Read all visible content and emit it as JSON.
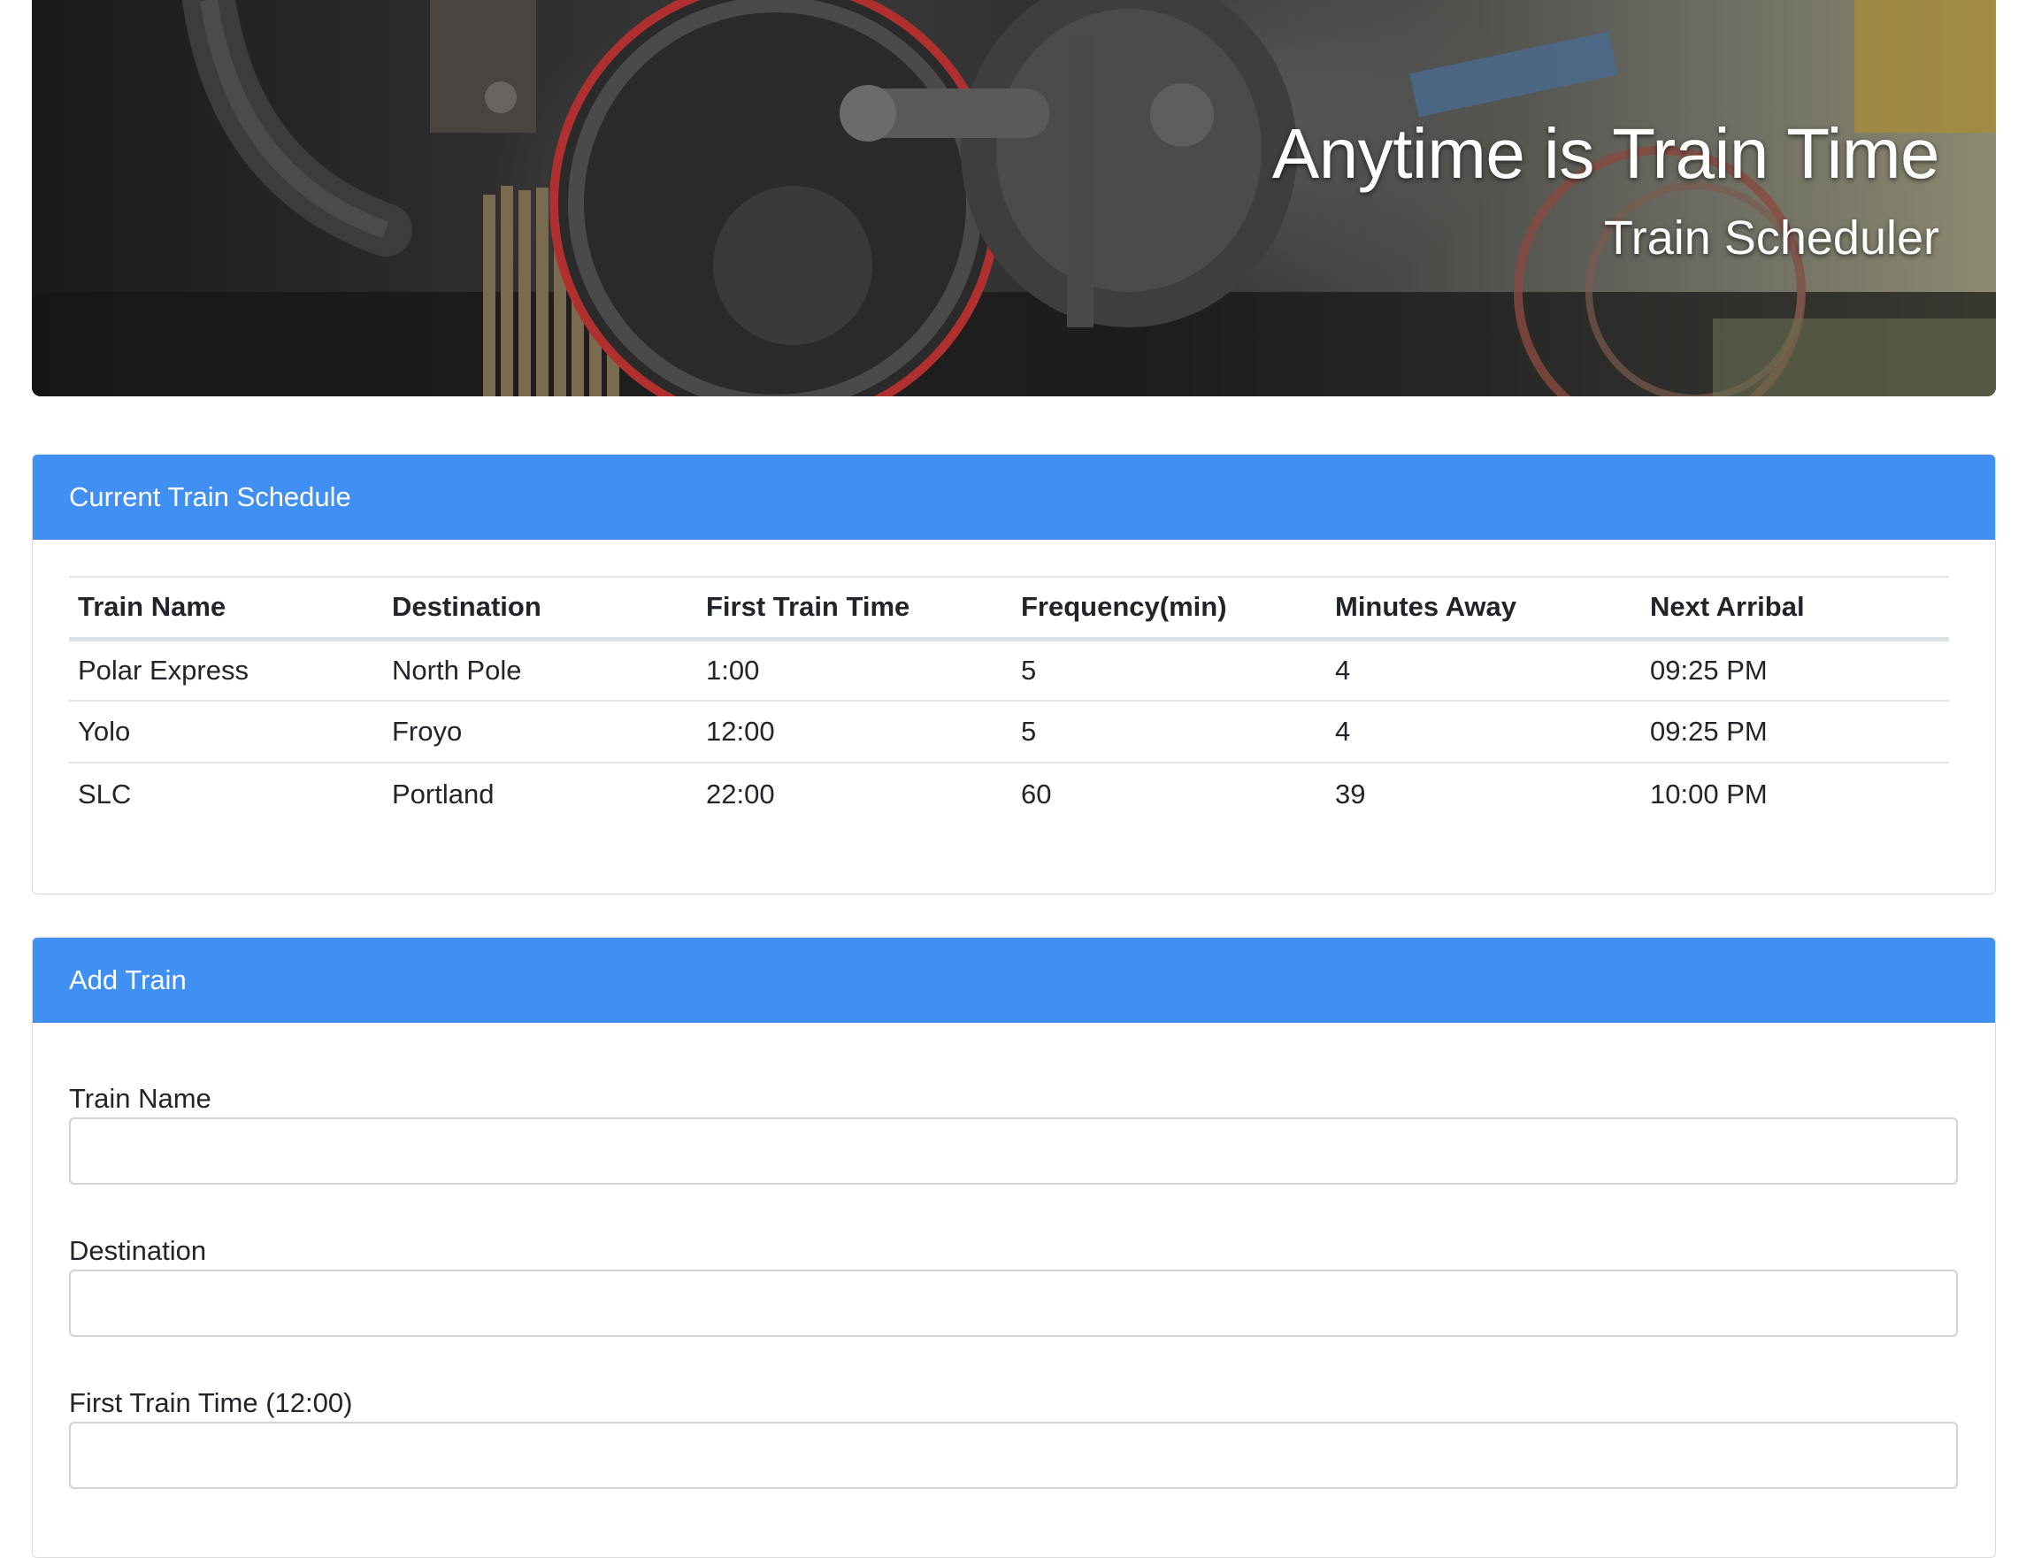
{
  "hero": {
    "title": "Anytime is Train Time",
    "subtitle": "Train Scheduler",
    "background_image": "steam-locomotive-wheels"
  },
  "schedule": {
    "header": "Current Train Schedule",
    "columns": [
      "Train Name",
      "Destination",
      "First Train Time",
      "Frequency(min)",
      "Minutes Away",
      "Next Arribal"
    ],
    "rows": [
      [
        "Polar Express",
        "North Pole",
        "1:00",
        "5",
        "4",
        "09:25 PM"
      ],
      [
        "Yolo",
        "Froyo",
        "12:00",
        "5",
        "4",
        "09:25 PM"
      ],
      [
        "SLC",
        "Portland",
        "22:00",
        "60",
        "39",
        "10:00 PM"
      ]
    ]
  },
  "add_train": {
    "header": "Add Train",
    "fields": [
      {
        "label": "Train Name",
        "value": "",
        "placeholder": ""
      },
      {
        "label": "Destination",
        "value": "",
        "placeholder": ""
      },
      {
        "label": "First Train Time (12:00)",
        "value": "",
        "placeholder": ""
      }
    ]
  },
  "colors": {
    "card_header": "#4090f3",
    "header_text": "#ffffff",
    "body_text": "#212529",
    "border": "#dcdcdc"
  }
}
